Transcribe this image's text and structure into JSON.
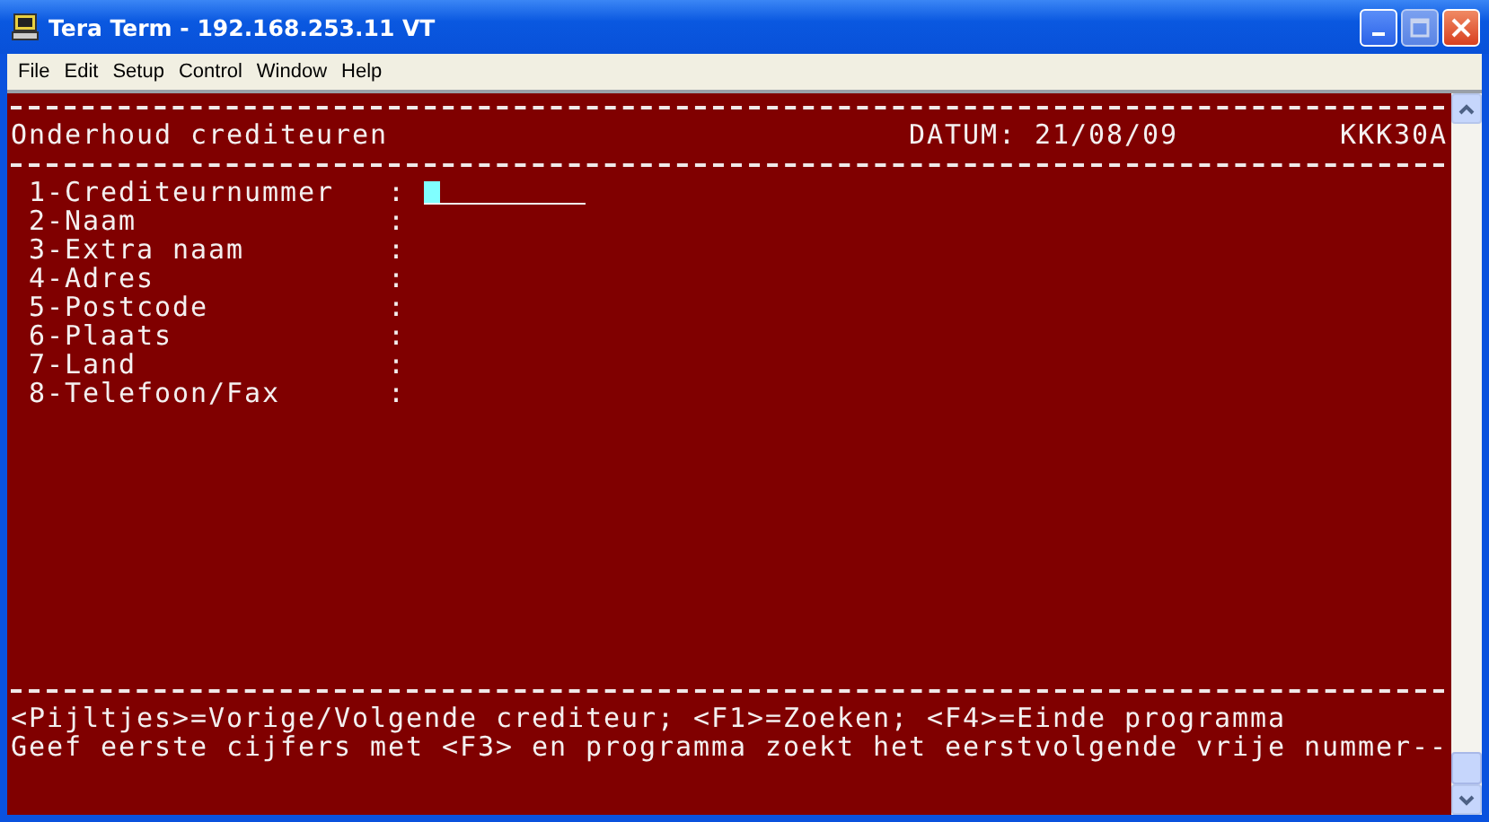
{
  "window": {
    "title": "Tera Term - 192.168.253.11 VT"
  },
  "menu": [
    {
      "label": "File"
    },
    {
      "label": "Edit"
    },
    {
      "label": "Setup"
    },
    {
      "label": "Control"
    },
    {
      "label": "Window"
    },
    {
      "label": "Help"
    }
  ],
  "terminal": {
    "header": {
      "title": "Onderhoud crediteuren",
      "date": "DATUM: 21/08/09",
      "program": "KKK30A"
    },
    "fields": [
      {
        "label": "1-Crediteurnummer",
        "separator": ":",
        "input": true,
        "cursor": true
      },
      {
        "label": "2-Naam",
        "separator": ":",
        "input": false,
        "cursor": false
      },
      {
        "label": "3-Extra naam",
        "separator": ":",
        "input": false,
        "cursor": false
      },
      {
        "label": "4-Adres",
        "separator": ":",
        "input": false,
        "cursor": false
      },
      {
        "label": "5-Postcode",
        "separator": ":",
        "input": false,
        "cursor": false
      },
      {
        "label": "6-Plaats",
        "separator": ":",
        "input": false,
        "cursor": false
      },
      {
        "label": "7-Land",
        "separator": ":",
        "input": false,
        "cursor": false
      },
      {
        "label": "8-Telefoon/Fax",
        "separator": ":",
        "input": false,
        "cursor": false
      }
    ],
    "footer": [
      "<Pijltjes>=Vorige/Volgende crediteur; <F1>=Zoeken; <F4>=Einde programma",
      "Geef eerste cijfers met <F3> en programma zoekt het eerstvolgende vrije nummer--"
    ]
  }
}
